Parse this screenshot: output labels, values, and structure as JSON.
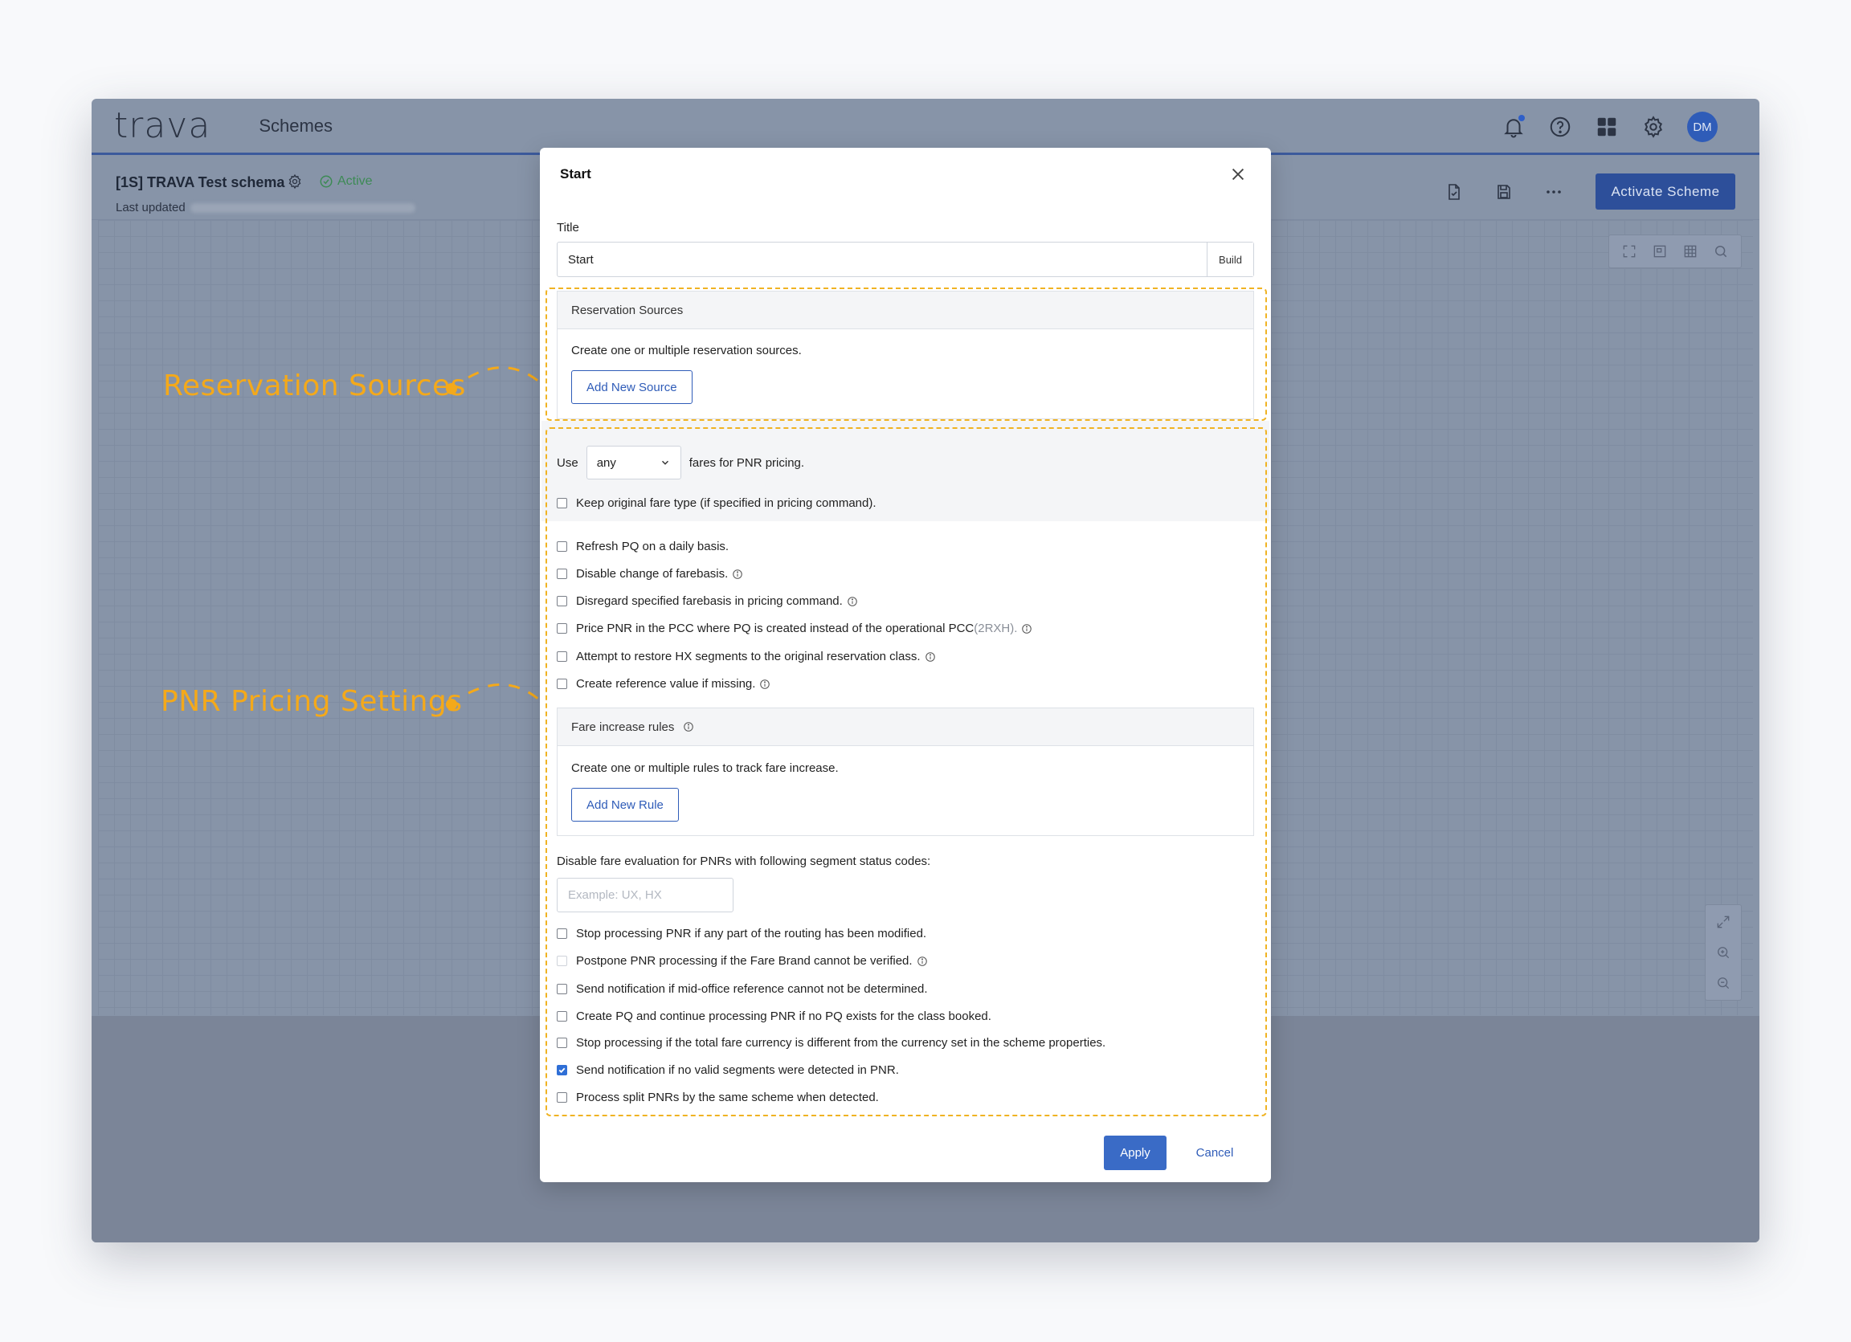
{
  "app": {
    "logo": "trava",
    "nav_title": "Schemes",
    "avatar_initials": "DM",
    "accent_color": "#2f5cb8"
  },
  "schema": {
    "name": "[1S] TRAVA Test schema",
    "status": "Active",
    "last_updated_label": "Last updated",
    "activate_label": "Activate Scheme"
  },
  "annotations": {
    "reservation_sources": "Reservation Sources",
    "pnr_pricing": "PNR Pricing Settings",
    "highlight_color": "#f4a91a"
  },
  "modal": {
    "title": "Start",
    "title_field_label": "Title",
    "title_value": "Start",
    "build_label": "Build",
    "reservation_sources": {
      "header": "Reservation Sources",
      "description": "Create one or multiple reservation sources.",
      "button": "Add New Source"
    },
    "use_prefix": "Use",
    "fare_select_value": "any",
    "use_suffix": "fares for PNR pricing.",
    "keep_original": "Keep original fare type (if specified in pricing command).",
    "options": [
      {
        "label": "Refresh PQ on a daily basis.",
        "checked": false
      },
      {
        "label": "Disable change of farebasis.",
        "checked": false
      },
      {
        "label": "Disregard specified farebasis in pricing command.",
        "checked": false
      },
      {
        "label": "Price PNR in the PCC where PQ is created instead of the operational PCC",
        "suffix": "(2RXH).",
        "checked": false
      },
      {
        "label": "Attempt to restore HX segments to the original reservation class.",
        "checked": false
      },
      {
        "label": "Create reference value if missing.",
        "checked": false
      }
    ],
    "fare_rules": {
      "header": "Fare increase rules",
      "description": "Create one or multiple rules to track fare increase.",
      "button": "Add New Rule"
    },
    "status_codes_label": "Disable fare evaluation for PNRs with following segment status codes:",
    "status_codes_placeholder": "Example: UX, HX",
    "more_options": [
      {
        "label": "Stop processing PNR if any part of the routing has been modified.",
        "checked": false
      },
      {
        "label": "Postpone PNR processing if the Fare Brand cannot be verified.",
        "checked": false
      },
      {
        "label": "Send notification if mid-office reference cannot not be determined.",
        "checked": false
      },
      {
        "label": "Create PQ and continue processing PNR if no PQ exists for the class booked.",
        "checked": false
      },
      {
        "label": "Stop processing if the total fare currency is different from the currency set in the scheme properties.",
        "checked": false
      },
      {
        "label": "Send notification if no valid segments were detected in PNR.",
        "checked": true
      },
      {
        "label": "Process split PNRs by the same scheme when detected.",
        "checked": false
      }
    ],
    "apply_label": "Apply",
    "cancel_label": "Cancel"
  }
}
